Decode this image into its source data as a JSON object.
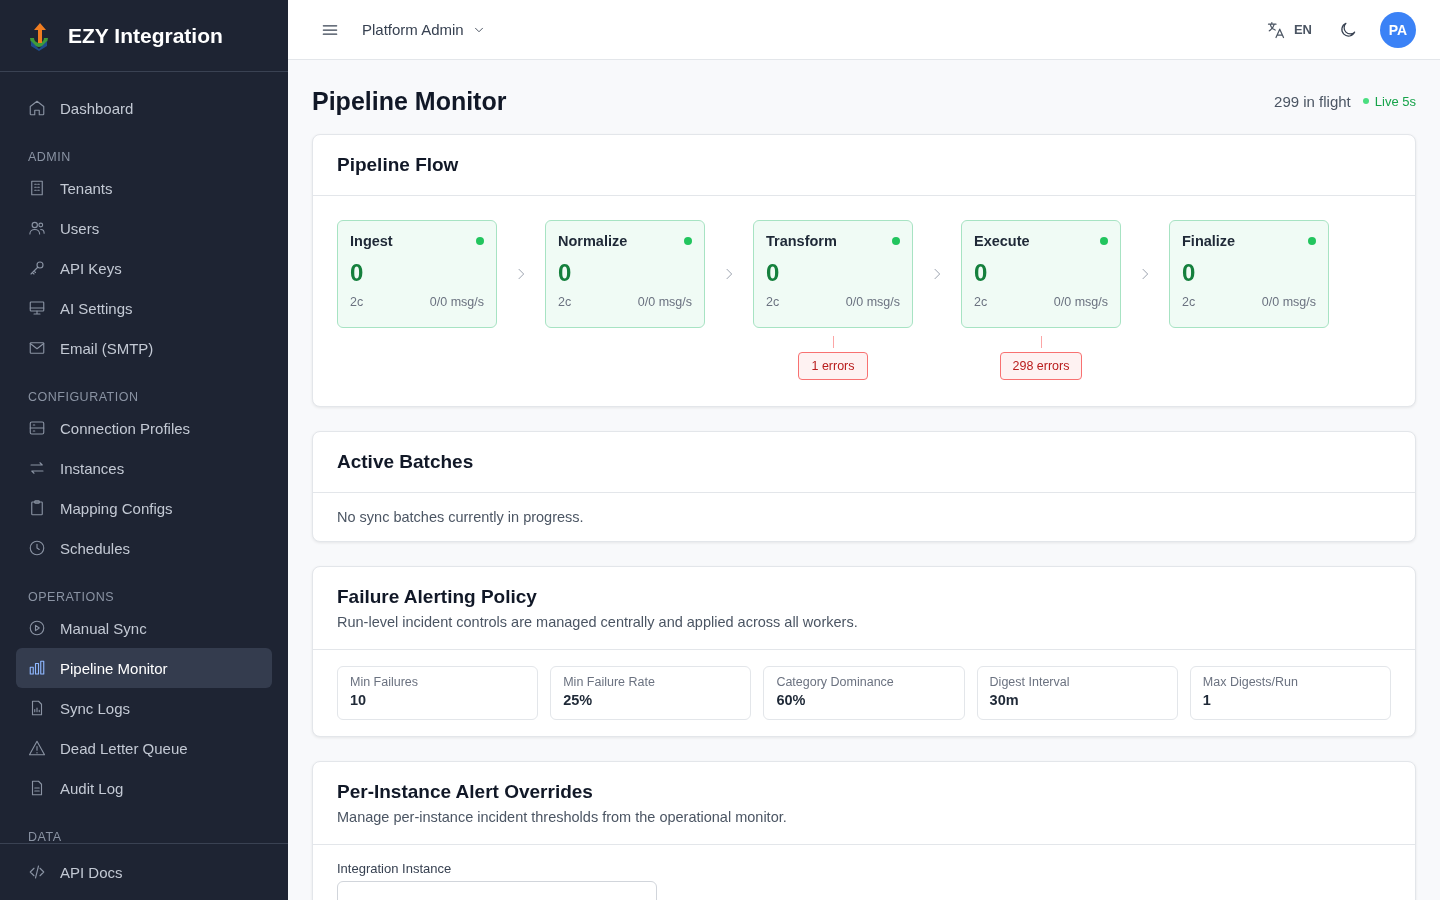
{
  "brand": {
    "name": "EZY Integration"
  },
  "sidebar": {
    "sections": [
      {
        "items": [
          {
            "label": "Dashboard",
            "selected": false
          }
        ]
      },
      {
        "heading": "ADMIN",
        "items": [
          {
            "label": "Tenants",
            "selected": false
          },
          {
            "label": "Users",
            "selected": false
          },
          {
            "label": "API Keys",
            "selected": false
          },
          {
            "label": "AI Settings",
            "selected": false
          },
          {
            "label": "Email (SMTP)",
            "selected": false
          }
        ]
      },
      {
        "heading": "CONFIGURATION",
        "items": [
          {
            "label": "Connection Profiles",
            "selected": false
          },
          {
            "label": "Instances",
            "selected": false
          },
          {
            "label": "Mapping Configs",
            "selected": false
          },
          {
            "label": "Schedules",
            "selected": false
          }
        ]
      },
      {
        "heading": "OPERATIONS",
        "items": [
          {
            "label": "Manual Sync",
            "selected": false
          },
          {
            "label": "Pipeline Monitor",
            "selected": true
          },
          {
            "label": "Sync Logs",
            "selected": false
          },
          {
            "label": "Dead Letter Queue",
            "selected": false
          },
          {
            "label": "Audit Log",
            "selected": false
          }
        ]
      },
      {
        "heading": "DATA"
      }
    ],
    "footer": [
      {
        "label": "API Docs",
        "selected": false
      }
    ]
  },
  "topbar": {
    "workspace": "Platform Admin",
    "language": "EN",
    "avatar": "PA"
  },
  "page": {
    "title": "Pipeline Monitor",
    "in_flight": "299 in flight",
    "live": true,
    "live_label": "Live 5s"
  },
  "pipeline_flow": {
    "title": "Pipeline Flow",
    "stages": [
      {
        "name": "Ingest",
        "healthy": true,
        "count": "0",
        "consumers": "2c",
        "rate": "0/0 msg/s"
      },
      {
        "name": "Normalize",
        "healthy": true,
        "count": "0",
        "consumers": "2c",
        "rate": "0/0 msg/s"
      },
      {
        "name": "Transform",
        "healthy": true,
        "count": "0",
        "consumers": "2c",
        "rate": "0/0 msg/s",
        "errors": "1 errors"
      },
      {
        "name": "Execute",
        "healthy": true,
        "count": "0",
        "consumers": "2c",
        "rate": "0/0 msg/s",
        "errors": "298 errors"
      },
      {
        "name": "Finalize",
        "healthy": true,
        "count": "0",
        "consumers": "2c",
        "rate": "0/0 msg/s"
      }
    ]
  },
  "active_batches": {
    "title": "Active Batches",
    "empty_text": "No sync batches currently in progress."
  },
  "failure_alerting_policy": {
    "title": "Failure Alerting Policy",
    "subtitle": "Run-level incident controls are managed centrally and applied across all workers.",
    "settings": [
      {
        "label": "Min Failures",
        "value": "10"
      },
      {
        "label": "Min Failure Rate",
        "value": "25%"
      },
      {
        "label": "Category Dominance",
        "value": "60%"
      },
      {
        "label": "Digest Interval",
        "value": "30m"
      },
      {
        "label": "Max Digests/Run",
        "value": "1"
      }
    ]
  },
  "per_instance_overrides": {
    "title": "Per-Instance Alert Overrides",
    "subtitle": "Manage per-instance incident thresholds from the operational monitor.",
    "field_label": "Integration Instance"
  }
}
